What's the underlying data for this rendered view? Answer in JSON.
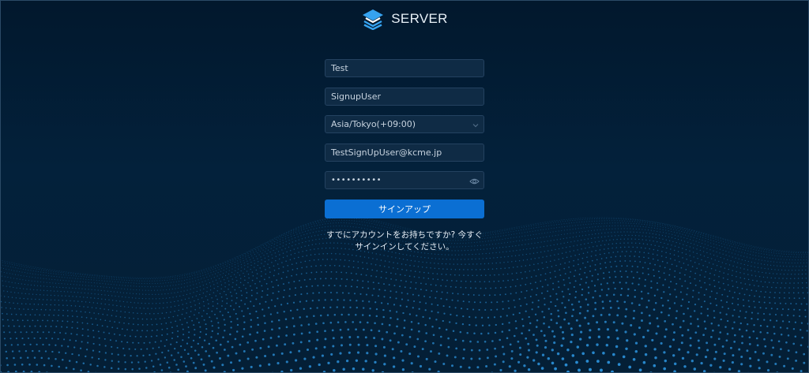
{
  "brand": {
    "name": "SERVER",
    "icon": "stacked-layers-icon",
    "accent_color": "#36a3f0"
  },
  "form": {
    "first_name": "Test",
    "last_name": "SignupUser",
    "timezone": "Asia/Tokyo(+09:00)",
    "email": "TestSignUpUser@kcme.jp",
    "password_masked": "••••••••••",
    "submit_label": "サインアップ",
    "signin_note": "すでにアカウントをお持ちですか? 今すぐサインインしてください。"
  },
  "colors": {
    "background": "#02182d",
    "button": "#0b6fd3",
    "dots": "#2f9be8"
  }
}
